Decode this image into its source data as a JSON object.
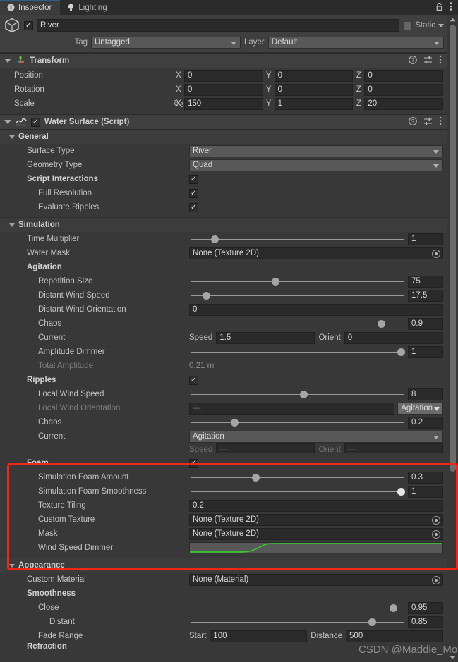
{
  "window": {
    "tabs": [
      {
        "label": "Inspector",
        "icon": "info-icon",
        "active": true
      },
      {
        "label": "Lighting",
        "icon": "light-bulb-icon",
        "active": false
      }
    ],
    "lock_icon": "lock-icon",
    "menu_icon": "kebab-menu-icon"
  },
  "gameobject": {
    "icon": "cube-icon",
    "enabled": true,
    "name": "River",
    "static_label": "Static",
    "static_checked": false,
    "tag_label": "Tag",
    "tag_value": "Untagged",
    "layer_label": "Layer",
    "layer_value": "Default"
  },
  "transform": {
    "title": "Transform",
    "icon": "transform-axis-icon",
    "help_icon": "help-icon",
    "preset_icon": "preset-icon",
    "menu_icon": "kebab-menu-icon",
    "rows": [
      {
        "label": "Position",
        "x": "0",
        "y": "0",
        "z": "0",
        "has_eye": false
      },
      {
        "label": "Rotation",
        "x": "0",
        "y": "0",
        "z": "0",
        "has_eye": false
      },
      {
        "label": "Scale",
        "x": "150",
        "y": "1",
        "z": "20",
        "has_eye": true,
        "eye_icon": "link-off-icon"
      }
    ],
    "axis_labels": [
      "X",
      "Y",
      "Z"
    ]
  },
  "water_surface": {
    "title": "Water Surface (Script)",
    "icon": "wave-icon",
    "enabled": true,
    "help_icon": "help-icon",
    "preset_icon": "preset-icon",
    "menu_icon": "kebab-menu-icon"
  },
  "general": {
    "header": "General",
    "surface_type": {
      "label": "Surface Type",
      "value": "River"
    },
    "geometry_type": {
      "label": "Geometry Type",
      "value": "Quad"
    },
    "script_interactions": {
      "label": "Script Interactions",
      "checked": true
    },
    "full_resolution": {
      "label": "Full Resolution",
      "checked": true
    },
    "evaluate_ripples": {
      "label": "Evaluate Ripples",
      "checked": true
    }
  },
  "simulation": {
    "header": "Simulation",
    "time_multiplier": {
      "label": "Time Multiplier",
      "value": "1",
      "knob_pct": 12
    },
    "water_mask": {
      "label": "Water Mask",
      "value": "None (Texture 2D)"
    },
    "agitation": {
      "label": "Agitation"
    },
    "repetition_size": {
      "label": "Repetition Size",
      "value": "75",
      "knob_pct": 40
    },
    "distant_wind_speed": {
      "label": "Distant Wind Speed",
      "value": "17.5",
      "knob_pct": 8
    },
    "distant_wind_orientation": {
      "label": "Distant Wind Orientation",
      "value": "0"
    },
    "chaos": {
      "label": "Chaos",
      "value": "0.9",
      "knob_pct": 89
    },
    "current": {
      "label": "Current",
      "speed_label": "Speed",
      "speed_value": "1.5",
      "orient_label": "Orient",
      "orient_value": "0"
    },
    "amplitude_dimmer": {
      "label": "Amplitude Dimmer",
      "value": "1",
      "knob_pct": 100
    },
    "total_amplitude": {
      "label": "Total Amplitude",
      "value": "0.21 m"
    },
    "ripples": {
      "label": "Ripples",
      "checked": true
    },
    "local_wind_speed": {
      "label": "Local Wind Speed",
      "value": "8",
      "knob_pct": 53
    },
    "local_wind_orientation": {
      "label": "Local Wind Orientation",
      "value": "—",
      "mode": "Agitation"
    },
    "ripple_chaos": {
      "label": "Chaos",
      "value": "0.2",
      "knob_pct": 21
    },
    "ripple_current": {
      "label": "Current",
      "value": "Agitation"
    },
    "ripple_current_speed": {
      "speed_label": "Speed",
      "speed_value": "—",
      "orient_label": "Orient",
      "orient_value": "—"
    }
  },
  "foam": {
    "label": "Foam",
    "checked": true,
    "simulation_foam_amount": {
      "label": "Simulation Foam Amount",
      "value": "0.3",
      "knob_pct": 31
    },
    "simulation_foam_smoothness": {
      "label": "Simulation Foam Smoothness",
      "value": "1",
      "knob_pct": 100
    },
    "texture_tiling": {
      "label": "Texture Tiling",
      "value": "0.2"
    },
    "custom_texture": {
      "label": "Custom Texture",
      "value": "None (Texture 2D)"
    },
    "mask": {
      "label": "Mask",
      "value": "None (Texture 2D)"
    },
    "wind_speed_dimmer": {
      "label": "Wind Speed Dimmer",
      "curve_color": "#35d12a"
    },
    "highlight_color": "#f22613"
  },
  "appearance": {
    "header": "Appearance",
    "custom_material": {
      "label": "Custom Material",
      "value": "None (Material)"
    },
    "smoothness": {
      "label": "Smoothness"
    },
    "close": {
      "label": "Close",
      "value": "0.95",
      "knob_pct": 95
    },
    "distant": {
      "label": "Distant",
      "value": "0.85",
      "knob_pct": 85
    },
    "fade_range": {
      "label": "Fade Range",
      "start_label": "Start",
      "start_value": "100",
      "distance_label": "Distance",
      "distance_value": "500"
    },
    "refraction": {
      "label": "Refraction"
    }
  },
  "watermark": {
    "text": "CSDN @Maddie_Mo"
  },
  "scrollbar": {
    "up_arrow": "scroll-up-arrow-icon",
    "down_arrow": "scroll-down-arrow-icon"
  }
}
